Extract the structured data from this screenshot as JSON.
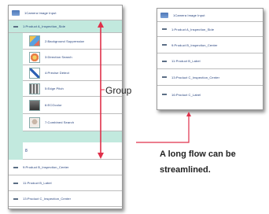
{
  "left_panel": {
    "rows": [
      {
        "label": "1Camera Image Input",
        "kind": "header"
      },
      {
        "label": "1:Product A_Inspection_Side",
        "kind": "item"
      },
      {
        "label": "2:Background Suppression",
        "kind": "tool"
      },
      {
        "label": "3:Direction Search",
        "kind": "tool"
      },
      {
        "label": "4:Precise Detect",
        "kind": "tool"
      },
      {
        "label": "5:Edge Pitch",
        "kind": "tool"
      },
      {
        "label": "6:ECOcolor",
        "kind": "tool"
      },
      {
        "label": "7:Combined Search",
        "kind": "tool"
      },
      {
        "label": "8",
        "kind": "plain"
      },
      {
        "label": "9:Product B_Inspection_Center",
        "kind": "item"
      },
      {
        "label": "11:Product B_Label",
        "kind": "item"
      },
      {
        "label": "13:Product C_Inspection_Center",
        "kind": "item"
      }
    ]
  },
  "right_panel": {
    "rows": [
      {
        "label": "1Camera Image Input",
        "kind": "header"
      },
      {
        "label": "1:Product A_Inspection_Side",
        "kind": "item"
      },
      {
        "label": "9:Product B_Inspection_Center",
        "kind": "item"
      },
      {
        "label": "11:Product B_Label",
        "kind": "item"
      },
      {
        "label": "13:Product C_Inspection_Center",
        "kind": "item"
      },
      {
        "label": "16:Product C_Label",
        "kind": "item"
      }
    ]
  },
  "annotations": {
    "group_label": "Group",
    "caption_line1": "A long flow can be",
    "caption_line2": "streamlined."
  },
  "colors": {
    "group_highlight": "#c2e9de",
    "arrow": "#e0304a",
    "text": "#1d3a78"
  }
}
